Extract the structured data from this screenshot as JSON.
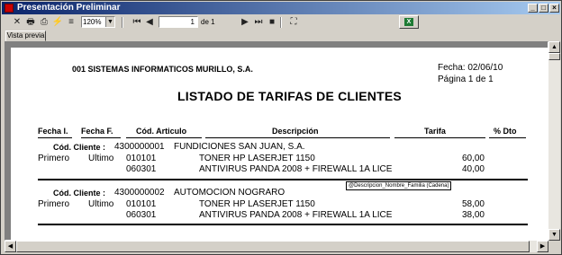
{
  "window": {
    "title": "Presentación Preliminar"
  },
  "toolbar": {
    "zoom": "120%",
    "page_current": "1",
    "page_of": "de 1",
    "icons": [
      "close-icon",
      "print-icon",
      "print-setup-icon",
      "export-icon",
      "tree-icon",
      "first-page-icon",
      "prev-page-icon",
      "next-page-icon",
      "last-page-icon",
      "stop-icon",
      "binoculars-icon",
      "excel-icon"
    ]
  },
  "tabs": {
    "preview": "Vista previa"
  },
  "report": {
    "company": "001 SISTEMAS INFORMATICOS MURILLO, S.A.",
    "fecha": "Fecha: 02/06/10",
    "pagina": "Página 1 de 1",
    "title": "LISTADO DE TARIFAS DE CLIENTES",
    "headers": {
      "fecha_i": "Fecha I.",
      "fecha_f": "Fecha F.",
      "cod_articulo": "Cód. Articulo",
      "descripcion": "Descripción",
      "tarifa": "Tarifa",
      "dto": "% Dto"
    },
    "groups": [
      {
        "label": "Cód. Cliente :",
        "code": "4300000001",
        "name": "FUNDICIONES SAN JUAN, S.A.",
        "rows": [
          {
            "fecha_i": "Primero",
            "fecha_f": "Ultimo",
            "articulo": "010101",
            "descripcion": "TONER HP LASERJET 1150",
            "tarifa": "60,00"
          },
          {
            "fecha_i": "",
            "fecha_f": "",
            "articulo": "060301",
            "descripcion": "ANTIVIRUS PANDA 2008 + FIREWALL 1A LICE",
            "tarifa": "40,00"
          }
        ]
      },
      {
        "label": "Cód. Cliente :",
        "code": "4300000002",
        "name": "AUTOMOCION NOGRARO",
        "rows": [
          {
            "fecha_i": "Primero",
            "fecha_f": "Ultimo",
            "articulo": "010101",
            "descripcion": "TONER HP LASERJET 1150",
            "tarifa": "58,00"
          },
          {
            "fecha_i": "",
            "fecha_f": "",
            "articulo": "060301",
            "descripcion": "ANTIVIRUS PANDA 2008 + FIREWALL 1A LICE",
            "tarifa": "38,00"
          }
        ]
      }
    ],
    "tooltip": "@Descripcion_Nombre_Familia (Cadena)"
  }
}
